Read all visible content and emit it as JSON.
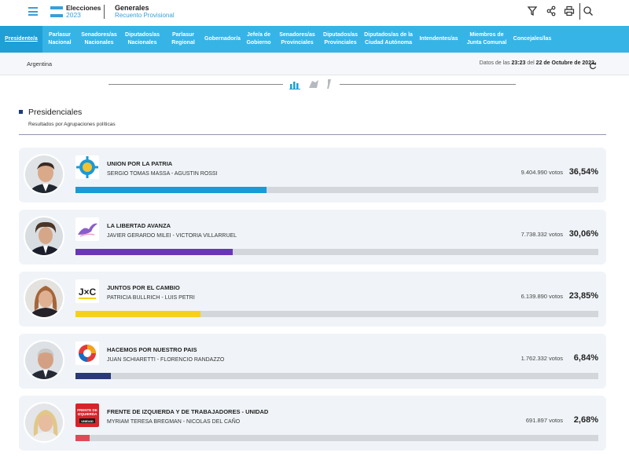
{
  "header": {
    "brand_title": "Elecciones",
    "brand_year": "2023",
    "subtitle": "Generales",
    "subtitle_sub": "Recuento Provisional"
  },
  "nav": {
    "items": [
      {
        "label": "Presidente/a",
        "active": true
      },
      {
        "label": "Parlasur\nNacional"
      },
      {
        "label": "Senadores/as\nNacionales"
      },
      {
        "label": "Diputados/as\nNacionales"
      },
      {
        "label": "Parlasur\nRegional"
      },
      {
        "label": "Gobernador/a"
      },
      {
        "label": "Jefe/a de\nGobierno"
      },
      {
        "label": "Senadores/as\nProvinciales"
      },
      {
        "label": "Diputados/as\nProvinciales"
      },
      {
        "label": "Diputados/as de la\nCiudad Autónoma"
      },
      {
        "label": "Intendentes/as"
      },
      {
        "label": "Miembros de\nJunta Comunal"
      },
      {
        "label": "Concejales/las"
      }
    ]
  },
  "subbar": {
    "country": "Argentina",
    "date_prefix": "Datos de las ",
    "time": "23:23",
    "date_mid": " del ",
    "date": "22 de Octubre de 2023"
  },
  "section": {
    "title": "Presidenciales",
    "subtitle": "Resultados por Agrupaciones políticas"
  },
  "results": [
    {
      "party": "UNION POR LA PATRIA",
      "candidates": "SERGIO TOMAS MASSA   -   AGUSTIN ROSSI",
      "votes": "9.404.990 votos",
      "pct_label": "36,54%",
      "pct": 36.54,
      "color": "#1a9ad6"
    },
    {
      "party": "LA LIBERTAD AVANZA",
      "candidates": "JAVIER GERARDO MILEI   -   VICTORIA VILLARRUEL",
      "votes": "7.738.332 votos",
      "pct_label": "30,06%",
      "pct": 30.06,
      "color": "#6a36b8"
    },
    {
      "party": "JUNTOS POR EL CAMBIO",
      "candidates": "PATRICIA BULLRICH   -   LUIS PETRI",
      "votes": "6.139.890 votos",
      "pct_label": "23,85%",
      "pct": 23.85,
      "color": "#f5d11c"
    },
    {
      "party": "HACEMOS POR NUESTRO PAIS",
      "candidates": "JUAN SCHIARETTI   -   FLORENCIO RANDAZZO",
      "votes": "1.762.332 votos",
      "pct_label": "6,84%",
      "pct": 6.84,
      "color": "#2a3978"
    },
    {
      "party": "FRENTE DE IZQUIERDA Y DE TRABAJADORES - UNIDAD",
      "candidates": "MYRIAM TERESA BREGMAN   -   NICOLAS DEL CAÑO",
      "votes": "691.897 votos",
      "pct_label": "2,68%",
      "pct": 2.68,
      "color": "#e04a58"
    }
  ],
  "logos": {
    "jxc_text": "J×C",
    "fit_line1": "FRENTE DE",
    "fit_line2": "IZQUIERDA",
    "fit_line3": "UNIDAD"
  }
}
